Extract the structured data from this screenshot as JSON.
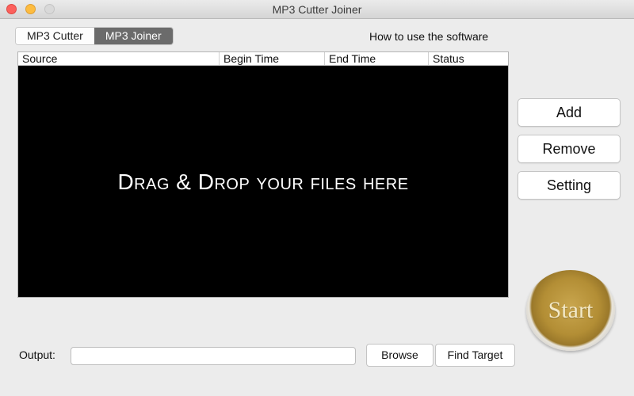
{
  "window": {
    "title": "MP3 Cutter Joiner"
  },
  "tabs": [
    {
      "label": "MP3 Cutter",
      "active": false
    },
    {
      "label": "MP3 Joiner",
      "active": true
    }
  ],
  "help_link": "How to use the software",
  "table": {
    "columns": [
      "Source",
      "Begin Time",
      "End Time",
      "Status"
    ],
    "rows": [],
    "empty_message": "Drag & Drop your files here"
  },
  "actions": {
    "add": "Add",
    "remove": "Remove",
    "setting": "Setting"
  },
  "start_label": "Start",
  "output": {
    "label": "Output:",
    "value": "",
    "placeholder": "",
    "browse": "Browse",
    "find_target": "Find Target"
  },
  "colors": {
    "accent_gold": "#b38e35",
    "active_tab": "#6b6b6b",
    "drop_zone": "#000000"
  }
}
